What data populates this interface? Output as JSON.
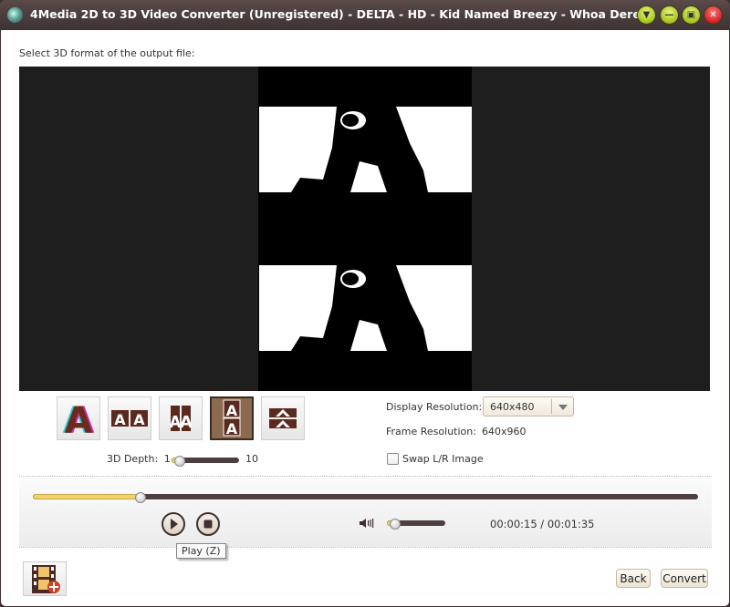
{
  "window": {
    "title": "4Media 2D to 3D Video Converter (Unregistered) - DELTA - HD - Kid Named Breezy - Whoa Dere",
    "buttons": [
      {
        "name": "menu",
        "icon": "chevron-down-icon"
      },
      {
        "name": "minimize",
        "icon": "minus-icon"
      },
      {
        "name": "maximize",
        "icon": "maximize-icon"
      },
      {
        "name": "close",
        "icon": "close-icon"
      }
    ]
  },
  "main": {
    "instruction": "Select 3D format of the output file:",
    "formats": [
      {
        "name": "anaglyph",
        "selected": false
      },
      {
        "name": "side-by-side",
        "selected": false
      },
      {
        "name": "side-by-side-half",
        "selected": false
      },
      {
        "name": "top-and-bottom",
        "selected": true
      },
      {
        "name": "top-and-bottom-half",
        "selected": false
      }
    ],
    "depth": {
      "label": "3D Depth:",
      "min": "1",
      "max": "10",
      "value": 2
    },
    "display_resolution": {
      "label": "Display Resolution:",
      "value": "640x480"
    },
    "frame_resolution": {
      "label": "Frame Resolution:",
      "value": "640x960"
    },
    "swap": {
      "label": "Swap L/R Image",
      "checked": false
    }
  },
  "player": {
    "progress_fraction": 0.16,
    "volume_fraction": 0.12,
    "time": "00:00:15 / 00:01:35",
    "play_tooltip": "Play (Z)"
  },
  "footer": {
    "back_label": "Back",
    "convert_label": "Convert"
  }
}
